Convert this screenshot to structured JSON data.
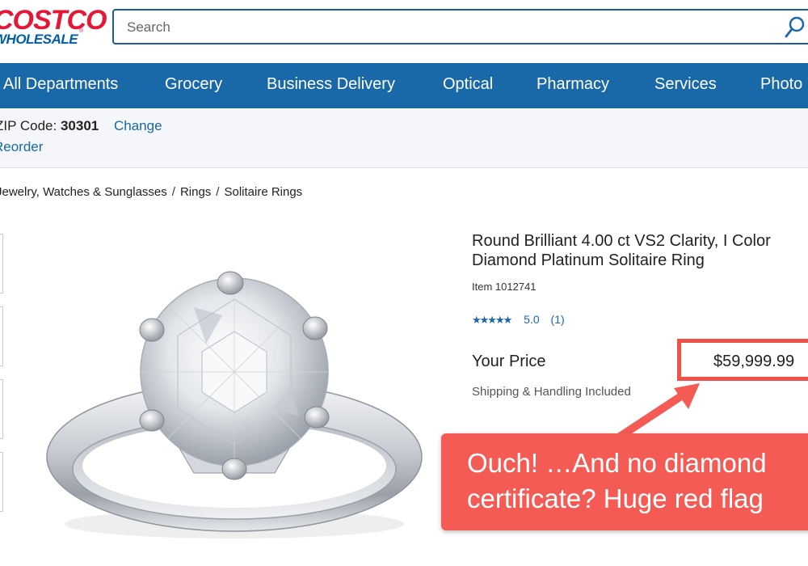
{
  "logo": {
    "line1": "COSTCO",
    "line2": "WHOLESALE",
    "reg": "®"
  },
  "search": {
    "placeholder": "Search"
  },
  "nav": {
    "items": [
      "All Departments",
      "Grocery",
      "Business Delivery",
      "Optical",
      "Pharmacy",
      "Services",
      "Photo"
    ]
  },
  "zip": {
    "label": "ZIP Code:",
    "code": "30301",
    "change": "Change",
    "reorder": "Reorder"
  },
  "breadcrumb": {
    "items": [
      "Jewelry, Watches & Sunglasses",
      "Rings",
      "Solitaire Rings"
    ],
    "separator": "/"
  },
  "product": {
    "title_line1": "Round Brilliant 4.00 ct VS2 Clarity, I Color",
    "title_line2": "Diamond Platinum Solitaire Ring",
    "item_label": "Item",
    "item_number": "1012741",
    "stars": "★★★★★",
    "rating": "5.0",
    "review_count": "(1)",
    "price_label": "Your Price",
    "price": "$59,999.99",
    "shipping": "Shipping & Handling Included"
  },
  "annotation": {
    "line1": "Ouch! …And no diamond",
    "line2": "certificate? Huge red flag",
    "color": "#f45b54"
  },
  "colors": {
    "nav": "#1968a8",
    "link": "#1968a8",
    "logo_red": "#e31837",
    "logo_blue": "#005daa"
  }
}
